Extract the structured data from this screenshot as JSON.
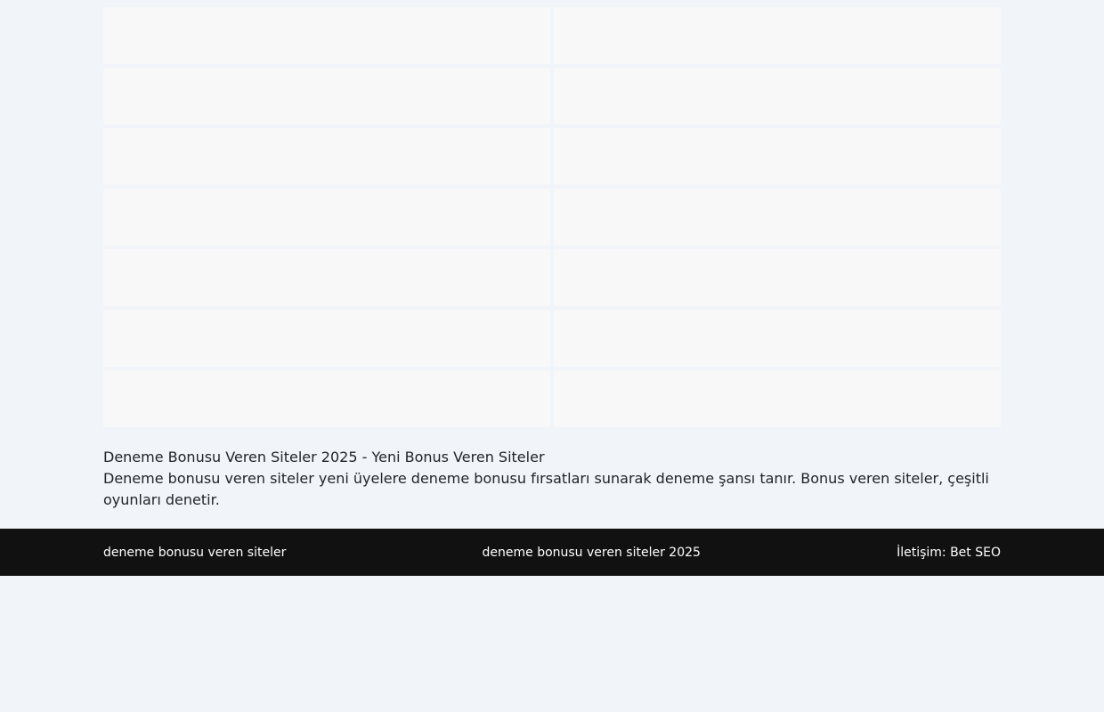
{
  "content": {
    "title": "Deneme Bonusu Veren Siteler 2025 - Yeni Bonus Veren Siteler",
    "description": "Deneme bonusu veren siteler yeni üyelere deneme bonusu fırsatları sunarak deneme şansı tanır. Bonus veren siteler, çeşitli oyunları denetir."
  },
  "footer": {
    "left_link": "deneme bonusu veren siteler",
    "center_link": "deneme bonusu veren siteler 2025",
    "contact": "İletişim: Bet SEO"
  },
  "colors": {
    "page_background": "#f1f4f9",
    "tile_background": "#f8f8f8",
    "footer_background": "#111111"
  }
}
